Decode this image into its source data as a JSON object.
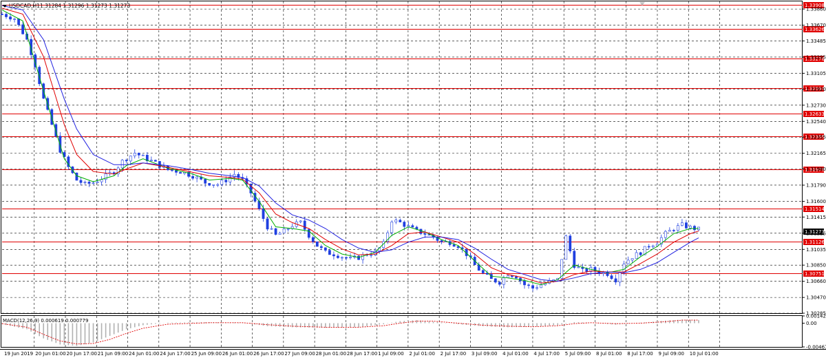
{
  "header": {
    "symbol_label": "USDCAD,H1",
    "ohlc_text": "1.31284 1.31296 1.31273 1.31273"
  },
  "macd_label": "MACD(12,26,9) 0.000619 0.000779",
  "colors": {
    "candle": "#1f3fe0",
    "ma_fast": "#00b000",
    "ma_mid": "#e00000",
    "ma_slow": "#2020e0",
    "level_line": "#e00000",
    "grid": "#000000",
    "macd_hist": "#b0b0b0",
    "macd_signal": "#e00000"
  },
  "chart_data": [
    {
      "type": "candlestick",
      "title": "",
      "current_price": "1.31273",
      "y_ticks": [
        "1.33860",
        "1.33670",
        "1.33485",
        "1.33295",
        "1.33105",
        "1.32920",
        "1.32730",
        "1.32540",
        "1.32355",
        "1.32165",
        "1.31980",
        "1.31790",
        "1.31600",
        "1.31415",
        "1.31225",
        "1.31035",
        "1.30850",
        "1.30660",
        "1.30470",
        "1.30285"
      ],
      "ylim": [
        1.30285,
        1.3395
      ],
      "x_ticks": [
        "19 Jun 2019",
        "20 Jun 01:00",
        "20 Jun 17:00",
        "21 Jun 09:00",
        "24 Jun 01:00",
        "24 Jun 17:00",
        "25 Jun 09:00",
        "26 Jun 01:00",
        "26 Jun 17:00",
        "27 Jun 09:00",
        "28 Jun 01:00",
        "28 Jun 17:00",
        "1 Jul 09:00",
        "2 Jul 01:00",
        "2 Jul 17:00",
        "3 Jul 09:00",
        "4 Jul 01:00",
        "4 Jul 17:00",
        "5 Jul 09:00",
        "8 Jul 01:00",
        "8 Jul 17:00",
        "9 Jul 09:00",
        "10 Jul 01:00"
      ],
      "levels": [
        "1.33908",
        "1.33626",
        "1.33278",
        "1.32934",
        "1.32633",
        "1.32366",
        "1.31978",
        "1.31514",
        "1.31126",
        "1.30751"
      ],
      "close_series": [
        [
          0,
          1.338
        ],
        [
          3,
          1.3375
        ],
        [
          6,
          1.335
        ],
        [
          8,
          1.332
        ],
        [
          10,
          1.328
        ],
        [
          12,
          1.325
        ],
        [
          14,
          1.322
        ],
        [
          16,
          1.32
        ],
        [
          18,
          1.3185
        ],
        [
          20,
          1.318
        ],
        [
          22,
          1.3182
        ],
        [
          24,
          1.3187
        ],
        [
          27,
          1.3195
        ],
        [
          29,
          1.3207
        ],
        [
          32,
          1.3217
        ],
        [
          34,
          1.3212
        ],
        [
          37,
          1.3205
        ],
        [
          40,
          1.3197
        ],
        [
          43,
          1.3195
        ],
        [
          46,
          1.319
        ],
        [
          49,
          1.3182
        ],
        [
          52,
          1.318
        ],
        [
          54,
          1.3185
        ],
        [
          56,
          1.3192
        ],
        [
          58,
          1.3185
        ],
        [
          60,
          1.317
        ],
        [
          62,
          1.315
        ],
        [
          64,
          1.313
        ],
        [
          66,
          1.312
        ],
        [
          68,
          1.3125
        ],
        [
          70,
          1.3132
        ],
        [
          72,
          1.3135
        ],
        [
          74,
          1.312
        ],
        [
          76,
          1.3108
        ],
        [
          78,
          1.31
        ],
        [
          80,
          1.3098
        ],
        [
          82,
          1.3095
        ],
        [
          84,
          1.3092
        ],
        [
          86,
          1.3094
        ],
        [
          88,
          1.3098
        ],
        [
          90,
          1.31
        ],
        [
          92,
          1.311
        ],
        [
          94,
          1.3138
        ],
        [
          96,
          1.3135
        ],
        [
          98,
          1.313
        ],
        [
          100,
          1.3125
        ],
        [
          102,
          1.3122
        ],
        [
          104,
          1.3118
        ],
        [
          106,
          1.3112
        ],
        [
          108,
          1.3112
        ],
        [
          110,
          1.3108
        ],
        [
          112,
          1.3098
        ],
        [
          114,
          1.3085
        ],
        [
          116,
          1.3075
        ],
        [
          118,
          1.3068
        ],
        [
          120,
          1.3065
        ],
        [
          122,
          1.3075
        ],
        [
          124,
          1.3072
        ],
        [
          126,
          1.3062
        ],
        [
          128,
          1.3058
        ],
        [
          130,
          1.3062
        ],
        [
          132,
          1.3065
        ],
        [
          134,
          1.3068
        ],
        [
          136,
          1.3118
        ],
        [
          138,
          1.3085
        ],
        [
          140,
          1.3078
        ],
        [
          142,
          1.308
        ],
        [
          144,
          1.3077
        ],
        [
          146,
          1.3075
        ],
        [
          148,
          1.3068
        ],
        [
          150,
          1.3088
        ],
        [
          152,
          1.3095
        ],
        [
          154,
          1.31
        ],
        [
          156,
          1.3108
        ],
        [
          158,
          1.3112
        ],
        [
          160,
          1.3122
        ],
        [
          162,
          1.3128
        ],
        [
          164,
          1.3132
        ],
        [
          166,
          1.3129
        ],
        [
          168,
          1.3127
        ]
      ],
      "series": [
        {
          "key": "ma_fast",
          "values": [
            [
              0,
              1.3385
            ],
            [
              5,
              1.3372
            ],
            [
              10,
              1.329
            ],
            [
              15,
              1.321
            ],
            [
              18,
              1.319
            ],
            [
              22,
              1.3183
            ],
            [
              27,
              1.319
            ],
            [
              30,
              1.3202
            ],
            [
              34,
              1.321
            ],
            [
              40,
              1.3199
            ],
            [
              46,
              1.3192
            ],
            [
              50,
              1.3185
            ],
            [
              55,
              1.3187
            ],
            [
              58,
              1.3185
            ],
            [
              62,
              1.316
            ],
            [
              66,
              1.313
            ],
            [
              70,
              1.3128
            ],
            [
              74,
              1.3125
            ],
            [
              78,
              1.3108
            ],
            [
              82,
              1.3098
            ],
            [
              86,
              1.3094
            ],
            [
              90,
              1.31
            ],
            [
              94,
              1.312
            ],
            [
              98,
              1.313
            ],
            [
              102,
              1.3124
            ],
            [
              106,
              1.3115
            ],
            [
              110,
              1.3108
            ],
            [
              114,
              1.309
            ],
            [
              118,
              1.3072
            ],
            [
              122,
              1.307
            ],
            [
              126,
              1.3067
            ],
            [
              130,
              1.3062
            ],
            [
              134,
              1.3068
            ],
            [
              138,
              1.3085
            ],
            [
              142,
              1.308
            ],
            [
              146,
              1.3076
            ],
            [
              150,
              1.308
            ],
            [
              154,
              1.3095
            ],
            [
              158,
              1.3107
            ],
            [
              162,
              1.3122
            ],
            [
              166,
              1.3128
            ],
            [
              168,
              1.3128
            ]
          ]
        },
        {
          "key": "ma_mid",
          "values": [
            [
              0,
              1.3387
            ],
            [
              5,
              1.338
            ],
            [
              10,
              1.333
            ],
            [
              15,
              1.325
            ],
            [
              18,
              1.3215
            ],
            [
              22,
              1.3195
            ],
            [
              27,
              1.3192
            ],
            [
              30,
              1.3198
            ],
            [
              34,
              1.3205
            ],
            [
              40,
              1.32
            ],
            [
              46,
              1.3194
            ],
            [
              50,
              1.319
            ],
            [
              55,
              1.3188
            ],
            [
              58,
              1.3186
            ],
            [
              62,
              1.317
            ],
            [
              66,
              1.3145
            ],
            [
              70,
              1.3135
            ],
            [
              74,
              1.3128
            ],
            [
              78,
              1.3115
            ],
            [
              82,
              1.3104
            ],
            [
              86,
              1.3097
            ],
            [
              90,
              1.3098
            ],
            [
              94,
              1.3108
            ],
            [
              98,
              1.3122
            ],
            [
              102,
              1.3124
            ],
            [
              106,
              1.3118
            ],
            [
              110,
              1.3112
            ],
            [
              114,
              1.3098
            ],
            [
              118,
              1.3082
            ],
            [
              122,
              1.3074
            ],
            [
              126,
              1.307
            ],
            [
              130,
              1.3064
            ],
            [
              134,
              1.3066
            ],
            [
              138,
              1.3074
            ],
            [
              142,
              1.3078
            ],
            [
              146,
              1.3077
            ],
            [
              150,
              1.3077
            ],
            [
              154,
              1.3087
            ],
            [
              158,
              1.3098
            ],
            [
              162,
              1.3112
            ],
            [
              166,
              1.3122
            ],
            [
              168,
              1.3125
            ]
          ]
        },
        {
          "key": "ma_slow",
          "values": [
            [
              0,
              1.339
            ],
            [
              5,
              1.3385
            ],
            [
              10,
              1.335
            ],
            [
              15,
              1.328
            ],
            [
              18,
              1.3245
            ],
            [
              22,
              1.3215
            ],
            [
              27,
              1.3203
            ],
            [
              30,
              1.3203
            ],
            [
              34,
              1.3205
            ],
            [
              40,
              1.3202
            ],
            [
              46,
              1.3197
            ],
            [
              50,
              1.3193
            ],
            [
              55,
              1.319
            ],
            [
              58,
              1.3188
            ],
            [
              62,
              1.3178
            ],
            [
              66,
              1.3158
            ],
            [
              70,
              1.3144
            ],
            [
              74,
              1.3138
            ],
            [
              78,
              1.3128
            ],
            [
              82,
              1.3115
            ],
            [
              86,
              1.3105
            ],
            [
              90,
              1.31
            ],
            [
              94,
              1.3103
            ],
            [
              98,
              1.3112
            ],
            [
              102,
              1.3118
            ],
            [
              106,
              1.3118
            ],
            [
              110,
              1.3115
            ],
            [
              114,
              1.3105
            ],
            [
              118,
              1.3092
            ],
            [
              122,
              1.308
            ],
            [
              126,
              1.3074
            ],
            [
              130,
              1.3068
            ],
            [
              134,
              1.3066
            ],
            [
              138,
              1.307
            ],
            [
              142,
              1.3075
            ],
            [
              146,
              1.3077
            ],
            [
              150,
              1.3076
            ],
            [
              154,
              1.308
            ],
            [
              158,
              1.3088
            ],
            [
              162,
              1.31
            ],
            [
              166,
              1.3112
            ],
            [
              168,
              1.3117
            ]
          ]
        }
      ]
    },
    {
      "type": "macd",
      "y_ticks": [
        "0.001424",
        "0.00",
        "-0.004678"
      ],
      "ylim": [
        -0.004678,
        0.001424
      ],
      "histogram": [
        [
          0,
          -0.0002
        ],
        [
          6,
          -0.0012
        ],
        [
          10,
          -0.003
        ],
        [
          14,
          -0.0042
        ],
        [
          18,
          -0.0045
        ],
        [
          22,
          -0.0038
        ],
        [
          26,
          -0.0025
        ],
        [
          30,
          -0.0012
        ],
        [
          34,
          -0.0004
        ],
        [
          40,
          0.0001
        ],
        [
          50,
          0.0002
        ],
        [
          58,
          0.0001
        ],
        [
          64,
          -0.0006
        ],
        [
          70,
          -0.0008
        ],
        [
          78,
          -0.0009
        ],
        [
          86,
          -0.0008
        ],
        [
          92,
          -0.0002
        ],
        [
          96,
          0.0004
        ],
        [
          100,
          0.0006
        ],
        [
          104,
          0.0003
        ],
        [
          110,
          -0.0002
        ],
        [
          116,
          -0.0006
        ],
        [
          122,
          -0.0008
        ],
        [
          128,
          -0.0007
        ],
        [
          134,
          -0.0004
        ],
        [
          138,
          0.0002
        ],
        [
          142,
          0.0001
        ],
        [
          148,
          -0.0003
        ],
        [
          154,
          0.0001
        ],
        [
          160,
          0.0005
        ],
        [
          164,
          0.0007
        ],
        [
          168,
          0.0006
        ]
      ],
      "signal": [
        [
          0,
          -0.0001
        ],
        [
          6,
          -0.0008
        ],
        [
          10,
          -0.0022
        ],
        [
          14,
          -0.0035
        ],
        [
          18,
          -0.0041
        ],
        [
          22,
          -0.004
        ],
        [
          26,
          -0.0032
        ],
        [
          30,
          -0.002
        ],
        [
          34,
          -0.001
        ],
        [
          40,
          -0.0002
        ],
        [
          50,
          0.0001
        ],
        [
          58,
          0.0001
        ],
        [
          64,
          -0.0003
        ],
        [
          70,
          -0.0006
        ],
        [
          78,
          -0.0008
        ],
        [
          86,
          -0.0008
        ],
        [
          92,
          -0.0005
        ],
        [
          96,
          0.0
        ],
        [
          100,
          0.0004
        ],
        [
          104,
          0.0004
        ],
        [
          110,
          0.0
        ],
        [
          116,
          -0.0004
        ],
        [
          122,
          -0.0006
        ],
        [
          128,
          -0.0007
        ],
        [
          134,
          -0.0005
        ],
        [
          138,
          -0.0001
        ],
        [
          142,
          0.0001
        ],
        [
          148,
          -0.0001
        ],
        [
          154,
          0.0
        ],
        [
          160,
          0.0003
        ],
        [
          164,
          0.0006
        ],
        [
          168,
          0.0006
        ]
      ]
    }
  ]
}
